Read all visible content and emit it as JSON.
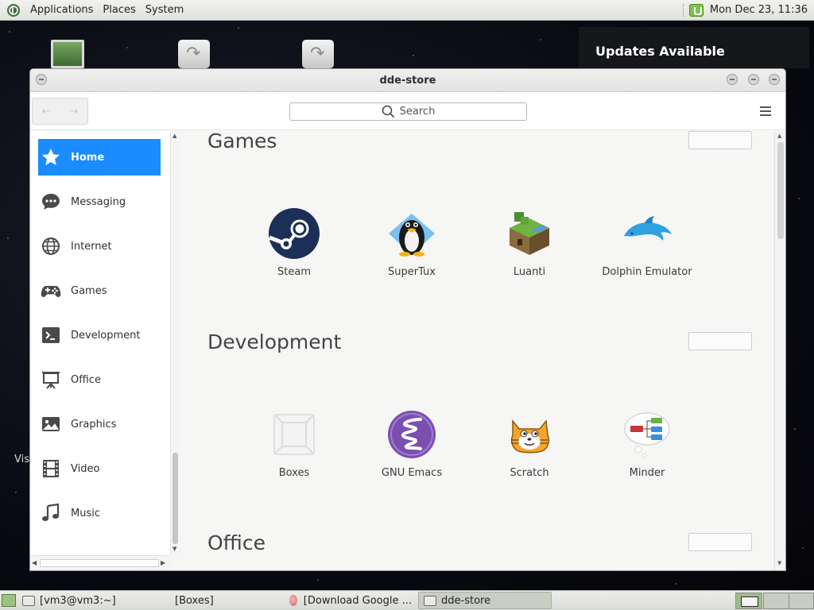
{
  "top_panel": {
    "menus": [
      "Applications",
      "Places",
      "System"
    ],
    "clock": "Mon Dec 23, 11:36"
  },
  "notification": {
    "text": "Updates Available"
  },
  "desktop": {
    "partial_label": "Vis"
  },
  "window": {
    "title": "dde-store",
    "search_placeholder": "Search",
    "sidebar": [
      {
        "label": "Home",
        "icon": "star-icon",
        "active": true
      },
      {
        "label": "Messaging",
        "icon": "chat-icon"
      },
      {
        "label": "Internet",
        "icon": "globe-icon"
      },
      {
        "label": "Games",
        "icon": "gamepad-icon"
      },
      {
        "label": "Development",
        "icon": "terminal-icon"
      },
      {
        "label": "Office",
        "icon": "presentation-icon"
      },
      {
        "label": "Graphics",
        "icon": "image-icon"
      },
      {
        "label": "Video",
        "icon": "film-icon"
      },
      {
        "label": "Music",
        "icon": "music-note-icon"
      }
    ],
    "sections": [
      {
        "title": "Games",
        "apps": [
          "Steam",
          "SuperTux",
          "Luanti",
          "Dolphin Emulator"
        ]
      },
      {
        "title": "Development",
        "apps": [
          "Boxes",
          "GNU Emacs",
          "Scratch",
          "Minder"
        ]
      },
      {
        "title": "Office",
        "apps": []
      }
    ]
  },
  "taskbar": {
    "tasks": [
      "[vm3@vm3:~]",
      "[Boxes]",
      "[Download Google ...",
      "dde-store"
    ]
  },
  "colors": {
    "accent": "#1a8cff",
    "top_panel": "#e6e8e3"
  }
}
